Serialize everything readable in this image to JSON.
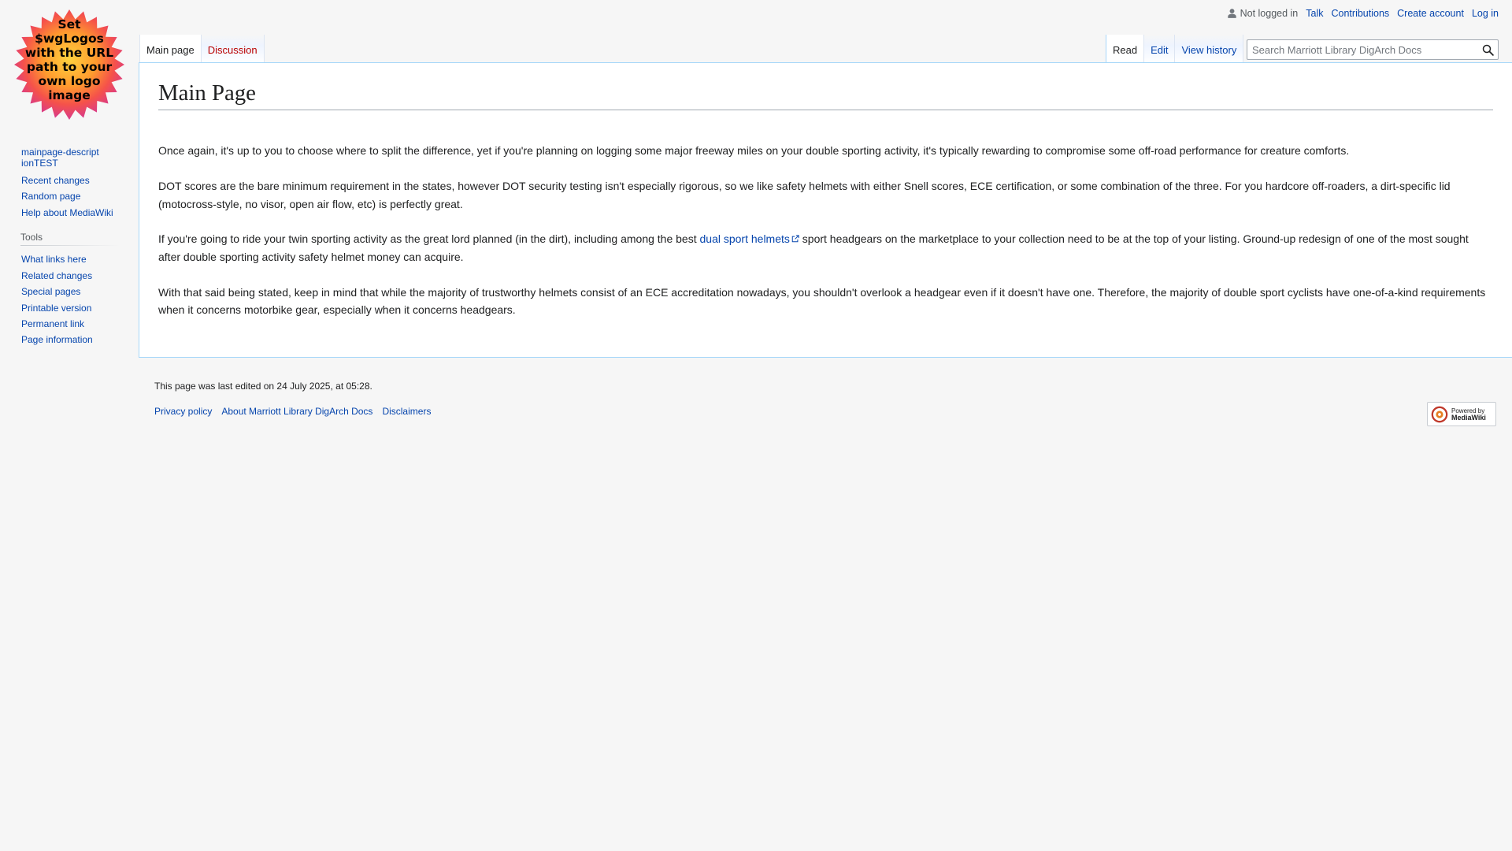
{
  "logo": {
    "text_lines": [
      "Set",
      "$wgLogos",
      "with the URL",
      "path to your",
      "own logo",
      "image"
    ]
  },
  "personal": {
    "user_status": "Not logged in",
    "links": [
      "Talk",
      "Contributions",
      "Create account",
      "Log in"
    ]
  },
  "tabs": {
    "left": [
      "Main page",
      "Discussion"
    ],
    "right": [
      "Read",
      "Edit",
      "View history"
    ]
  },
  "search": {
    "placeholder": "Search Marriott Library DigArch Docs"
  },
  "sidebar": {
    "navigation": [
      "mainpage-descriptionTEST",
      "Recent changes",
      "Random page",
      "Help about MediaWiki"
    ],
    "tools_heading": "Tools",
    "tools": [
      "What links here",
      "Related changes",
      "Special pages",
      "Printable version",
      "Permanent link",
      "Page information"
    ]
  },
  "page": {
    "title": "Main Page",
    "paragraphs": {
      "p1": "Once again, it's up to you to choose where to split the difference, yet if you're planning on logging some major freeway miles on your double sporting activity, it's typically rewarding to compromise some off-road performance for creature comforts.",
      "p2": "DOT scores are the bare minimum requirement in the states, however DOT security testing isn't especially rigorous, so we like safety helmets with either Snell scores, ECE certification, or some combination of the three. For you hardcore off-roaders, a dirt-specific lid (motocross-style, no visor, open air flow, etc) is perfectly great.",
      "p3_before": "If you're going to ride your twin sporting activity as the great lord planned (in the dirt), including among the best ",
      "p3_link": "dual sport helmets",
      "p3_after": " sport headgears on the marketplace to your collection need to be at the top of your listing. Ground-up redesign of one of the most sought after double sporting activity safety helmet money can acquire.",
      "p4": "With that said being stated, keep in mind that while the majority of trustworthy helmets consist of an ECE accreditation nowadays, you shouldn't overlook a headgear even if it doesn't have one. Therefore, the majority of double sport cyclists have one-of-a-kind requirements when it concerns motorbike gear, especially when it concerns headgears."
    }
  },
  "footer": {
    "last_modified": "This page was last edited on 24 July 2025, at 05:28.",
    "links": [
      "Privacy policy",
      "About Marriott Library DigArch Docs",
      "Disclaimers"
    ],
    "powered_by_line1": "Powered by",
    "powered_by_line2": "MediaWiki"
  },
  "icons": {
    "user": "user-icon",
    "search": "search-icon",
    "external_link": "external-link-icon",
    "mediawiki": "mediawiki-logo-icon"
  },
  "colors": {
    "link": "#0645ad",
    "new_link": "#ba0000",
    "border_blue": "#a7d7f9",
    "background": "#f6f6f6"
  }
}
